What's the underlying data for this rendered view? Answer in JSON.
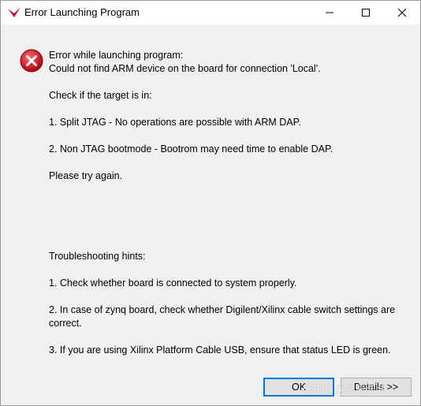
{
  "window": {
    "title": "Error Launching Program",
    "controls": {
      "minimize_icon": "minimize-icon",
      "maximize_icon": "maximize-icon",
      "close_icon": "close-icon"
    },
    "app_icon": "xilinx-logo-icon"
  },
  "dialog": {
    "icon": "error-icon",
    "error_heading": "Error while launching program:",
    "error_detail": "Could not find ARM device on the board for connection 'Local'.",
    "check_intro": "Check if the target is in:",
    "check_1": "1. Split JTAG - No operations are possible with ARM DAP.",
    "check_2": "2. Non JTAG bootmode - Bootrom may need time to enable DAP.",
    "retry": "Please try again.",
    "hints_heading": "Troubleshooting hints:",
    "hint_1": "1. Check whether board is connected to system properly.",
    "hint_2": "2. In case of zynq board, check whether Digilent/Xilinx cable switch settings are correct.",
    "hint_3": "3. If you are using Xilinx Platform Cable USB, ensure that status LED is green."
  },
  "buttons": {
    "ok_label": "OK",
    "details_label": "Details >>"
  },
  "watermark": "CSDN @星辰法斗",
  "colors": {
    "accent": "#0078d7",
    "error_red": "#d0021b",
    "brand_red": "#c8102e"
  }
}
